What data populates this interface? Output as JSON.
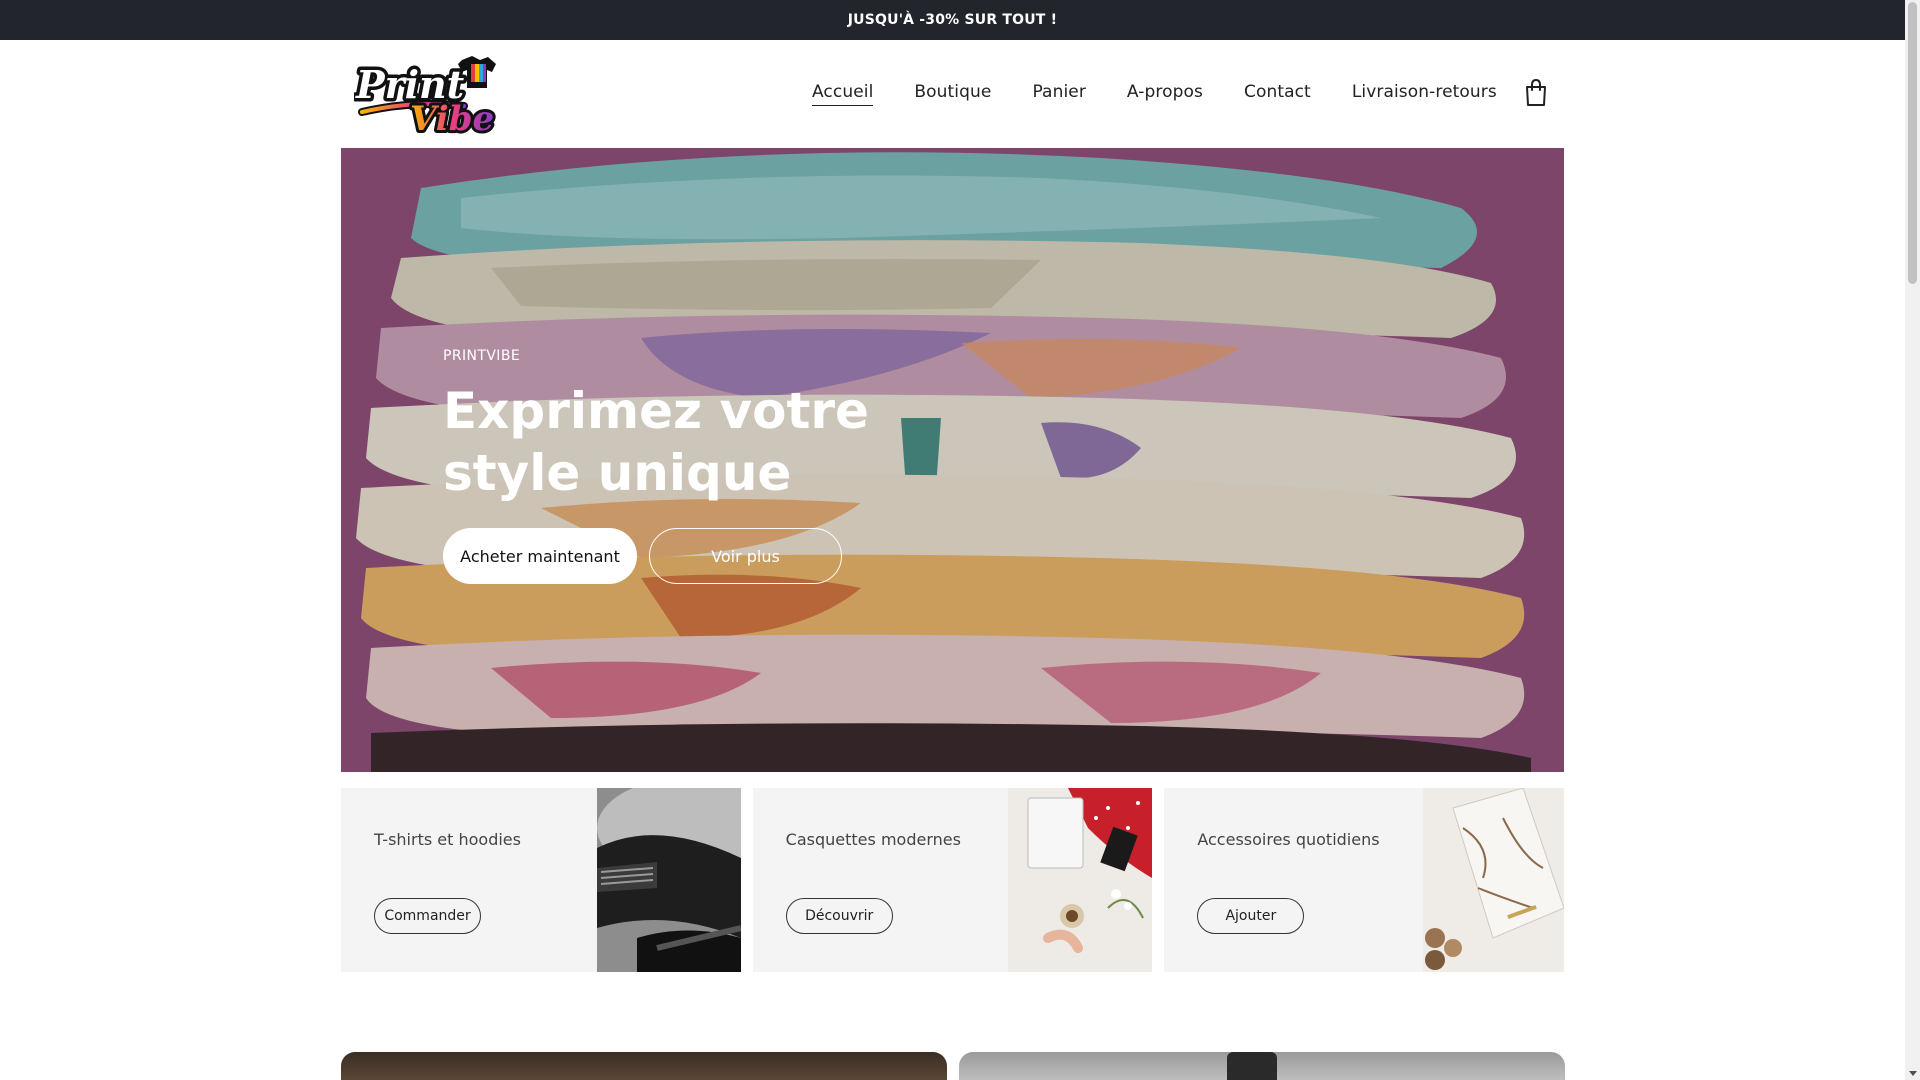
{
  "announcement": {
    "text": "JUSQU'À -30% SUR TOUT !"
  },
  "header": {
    "logo_text": "Print Vibe",
    "nav": [
      {
        "label": "Accueil",
        "active": true
      },
      {
        "label": "Boutique",
        "active": false
      },
      {
        "label": "Panier",
        "active": false
      },
      {
        "label": "A-propos",
        "active": false
      },
      {
        "label": "Contact",
        "active": false
      },
      {
        "label": "Livraison-retours",
        "active": false
      }
    ],
    "cart_icon": "shopping-bag-icon"
  },
  "hero": {
    "eyebrow": "PRINTVIBE",
    "title_line1": "Exprimez votre",
    "title_line2": "style unique",
    "primary_button": "Acheter maintenant",
    "secondary_button": "Voir plus",
    "overlay_color": "#8e4d76"
  },
  "collections": [
    {
      "title": "T-shirts et hoodies",
      "button": "Commander"
    },
    {
      "title": "Casquettes modernes",
      "button": "Découvrir"
    },
    {
      "title": "Accessoires quotidiens",
      "button": "Ajouter"
    }
  ],
  "colors": {
    "announcement_bg": "#22252b",
    "card_bg": "#f4f4f5",
    "text": "#222222"
  }
}
